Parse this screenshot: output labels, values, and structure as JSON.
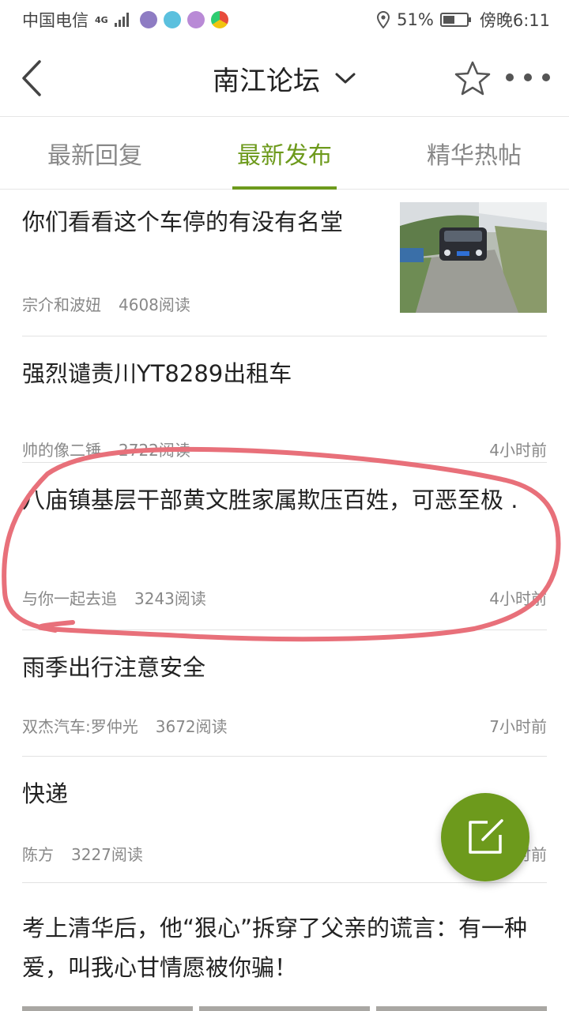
{
  "status_bar": {
    "carrier": "中国电信",
    "network": "4G",
    "battery_percent": "51%",
    "battery_level": 0.51,
    "time": "傍晚6:11"
  },
  "header": {
    "title": "南江论坛"
  },
  "tabs": [
    {
      "label": "最新回复",
      "active": false
    },
    {
      "label": "最新发布",
      "active": true
    },
    {
      "label": "精华热帖",
      "active": false
    }
  ],
  "posts": [
    {
      "title": "你们看看这个车停的有没有名堂",
      "author": "宗介和波妞",
      "reads": "4608阅读",
      "time": ""
    },
    {
      "title": "强烈谴责川YT8289出租车",
      "author": "帅的像二锤",
      "reads": "2722阅读",
      "time": "4小时前"
    },
    {
      "title": "八庙镇基层干部黄文胜家属欺压百姓，可恶至极 .",
      "author": "与你一起去追",
      "reads": "3243阅读",
      "time": "4小时前"
    },
    {
      "title": "雨季出行注意安全",
      "author": "双杰汽车:罗仲光",
      "reads": "3672阅读",
      "time": "7小时前"
    },
    {
      "title": "快递",
      "author": "陈方",
      "reads": "3227阅读",
      "time": "7小时前"
    },
    {
      "title": "考上清华后，他“狠心”拆穿了父亲的谎言：有一种爱，叫我心甘情愿被你骗！",
      "author": "",
      "reads": "",
      "time": ""
    }
  ],
  "colors": {
    "accent": "#6d9a1c",
    "annotation": "#e8707a"
  }
}
